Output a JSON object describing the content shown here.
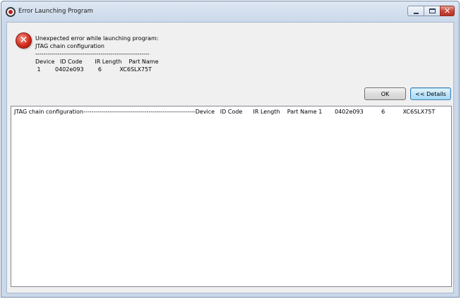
{
  "window": {
    "title": "Error Launching Program"
  },
  "caption_buttons": {
    "close_glyph": "✕"
  },
  "error": {
    "icon": "error-x-icon",
    "icon_glyph": "✕",
    "message": "Unexpected error while launching program:\nJTAG chain configuration\n--------------------------------------------------------\nDevice   ID Code       IR Length    Part Name\n 1        0402e093        6          XC6SLX75T"
  },
  "buttons": {
    "ok_label": "OK",
    "details_label": "<< Details"
  },
  "details": {
    "text": "JTAG chain configuration-------------------------------------------------------Device   ID Code      IR Length    Part Name 1       0402e093          6          XC6SLX75T"
  },
  "colors": {
    "error_red": "#d32c1c",
    "close_button_red": "#c9473a",
    "focus_blue": "#3c7fb1"
  }
}
